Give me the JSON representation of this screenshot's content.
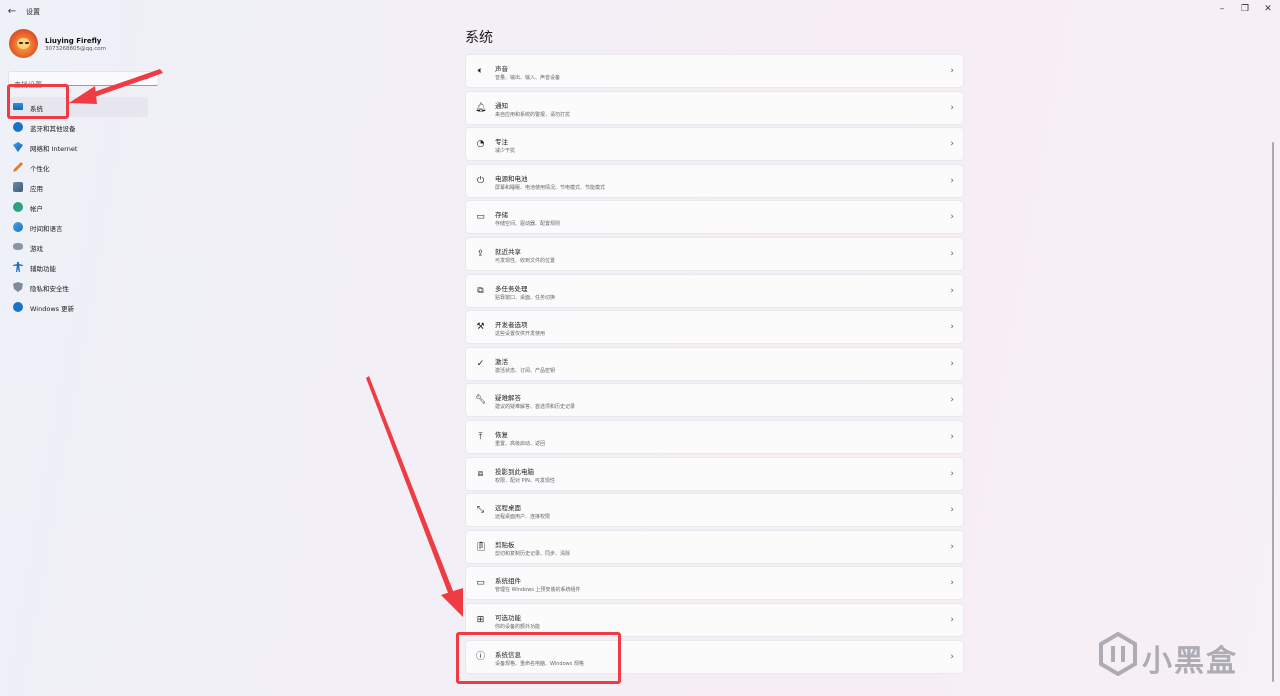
{
  "window": {
    "title": "设置",
    "back_icon": "back-arrow-icon",
    "controls": [
      "minimize-icon",
      "maximize-icon",
      "close-icon"
    ]
  },
  "profile": {
    "name": "Liuying Firefly",
    "email": "3073268805@qq.com"
  },
  "search": {
    "placeholder": "查找设置",
    "icon": "search-icon"
  },
  "sidebar": {
    "items": [
      {
        "label": "系统",
        "icon": "system-icon",
        "active": true
      },
      {
        "label": "蓝牙和其他设备",
        "icon": "bluetooth-icon"
      },
      {
        "label": "网络和 Internet",
        "icon": "network-icon"
      },
      {
        "label": "个性化",
        "icon": "brush-icon"
      },
      {
        "label": "应用",
        "icon": "apps-icon"
      },
      {
        "label": "帐户",
        "icon": "account-icon"
      },
      {
        "label": "时间和语言",
        "icon": "globe-clock-icon"
      },
      {
        "label": "游戏",
        "icon": "gamepad-icon"
      },
      {
        "label": "辅助功能",
        "icon": "accessibility-icon"
      },
      {
        "label": "隐私和安全性",
        "icon": "shield-icon"
      },
      {
        "label": "Windows 更新",
        "icon": "update-icon"
      }
    ]
  },
  "main": {
    "title": "系统",
    "cards": [
      {
        "title": "声音",
        "subtitle": "音量、输出、输入、声音设备",
        "icon": "speaker-icon"
      },
      {
        "title": "通知",
        "subtitle": "来自应用和系统的警报，请勿打扰",
        "icon": "bell-icon"
      },
      {
        "title": "专注",
        "subtitle": "减少干扰",
        "icon": "focus-icon"
      },
      {
        "title": "电源和电池",
        "subtitle": "屏幕和睡眠、电池使用情况、节电模式、节能模式",
        "icon": "power-icon"
      },
      {
        "title": "存储",
        "subtitle": "存储空间、驱动器、配置规则",
        "icon": "storage-icon"
      },
      {
        "title": "就近共享",
        "subtitle": "可发现性、收到文件的位置",
        "icon": "share-icon"
      },
      {
        "title": "多任务处理",
        "subtitle": "贴靠窗口、桌面、任务切换",
        "icon": "multitask-icon"
      },
      {
        "title": "开发者选项",
        "subtitle": "这些设置仅供开发使用",
        "icon": "developer-icon"
      },
      {
        "title": "激活",
        "subtitle": "激活状态、订阅、产品密钥",
        "icon": "check-circle-icon"
      },
      {
        "title": "疑难解答",
        "subtitle": "建议的疑难解答、首选项和历史记录",
        "icon": "wrench-icon"
      },
      {
        "title": "恢复",
        "subtitle": "重置、高级启动、返回",
        "icon": "recovery-icon"
      },
      {
        "title": "投影到此电脑",
        "subtitle": "权限、配对 PIN、可发现性",
        "icon": "projection-icon"
      },
      {
        "title": "远程桌面",
        "subtitle": "远程桌面用户、连接权限",
        "icon": "remote-desktop-icon"
      },
      {
        "title": "剪贴板",
        "subtitle": "剪切和复制历史记录、同步、清除",
        "icon": "clipboard-icon"
      },
      {
        "title": "系统组件",
        "subtitle": "管理在 Windows 上预安装的系统组件",
        "icon": "components-icon"
      },
      {
        "title": "可选功能",
        "subtitle": "你的设备的额外功能",
        "icon": "optional-features-icon"
      },
      {
        "title": "系统信息",
        "subtitle": "设备规格、重命名电脑、Windows 规格",
        "icon": "info-icon"
      }
    ]
  },
  "annotations": {
    "highlight_color": "#ef3b43"
  },
  "watermark": {
    "text": "小黑盒",
    "icon": "heybox-logo-icon"
  }
}
